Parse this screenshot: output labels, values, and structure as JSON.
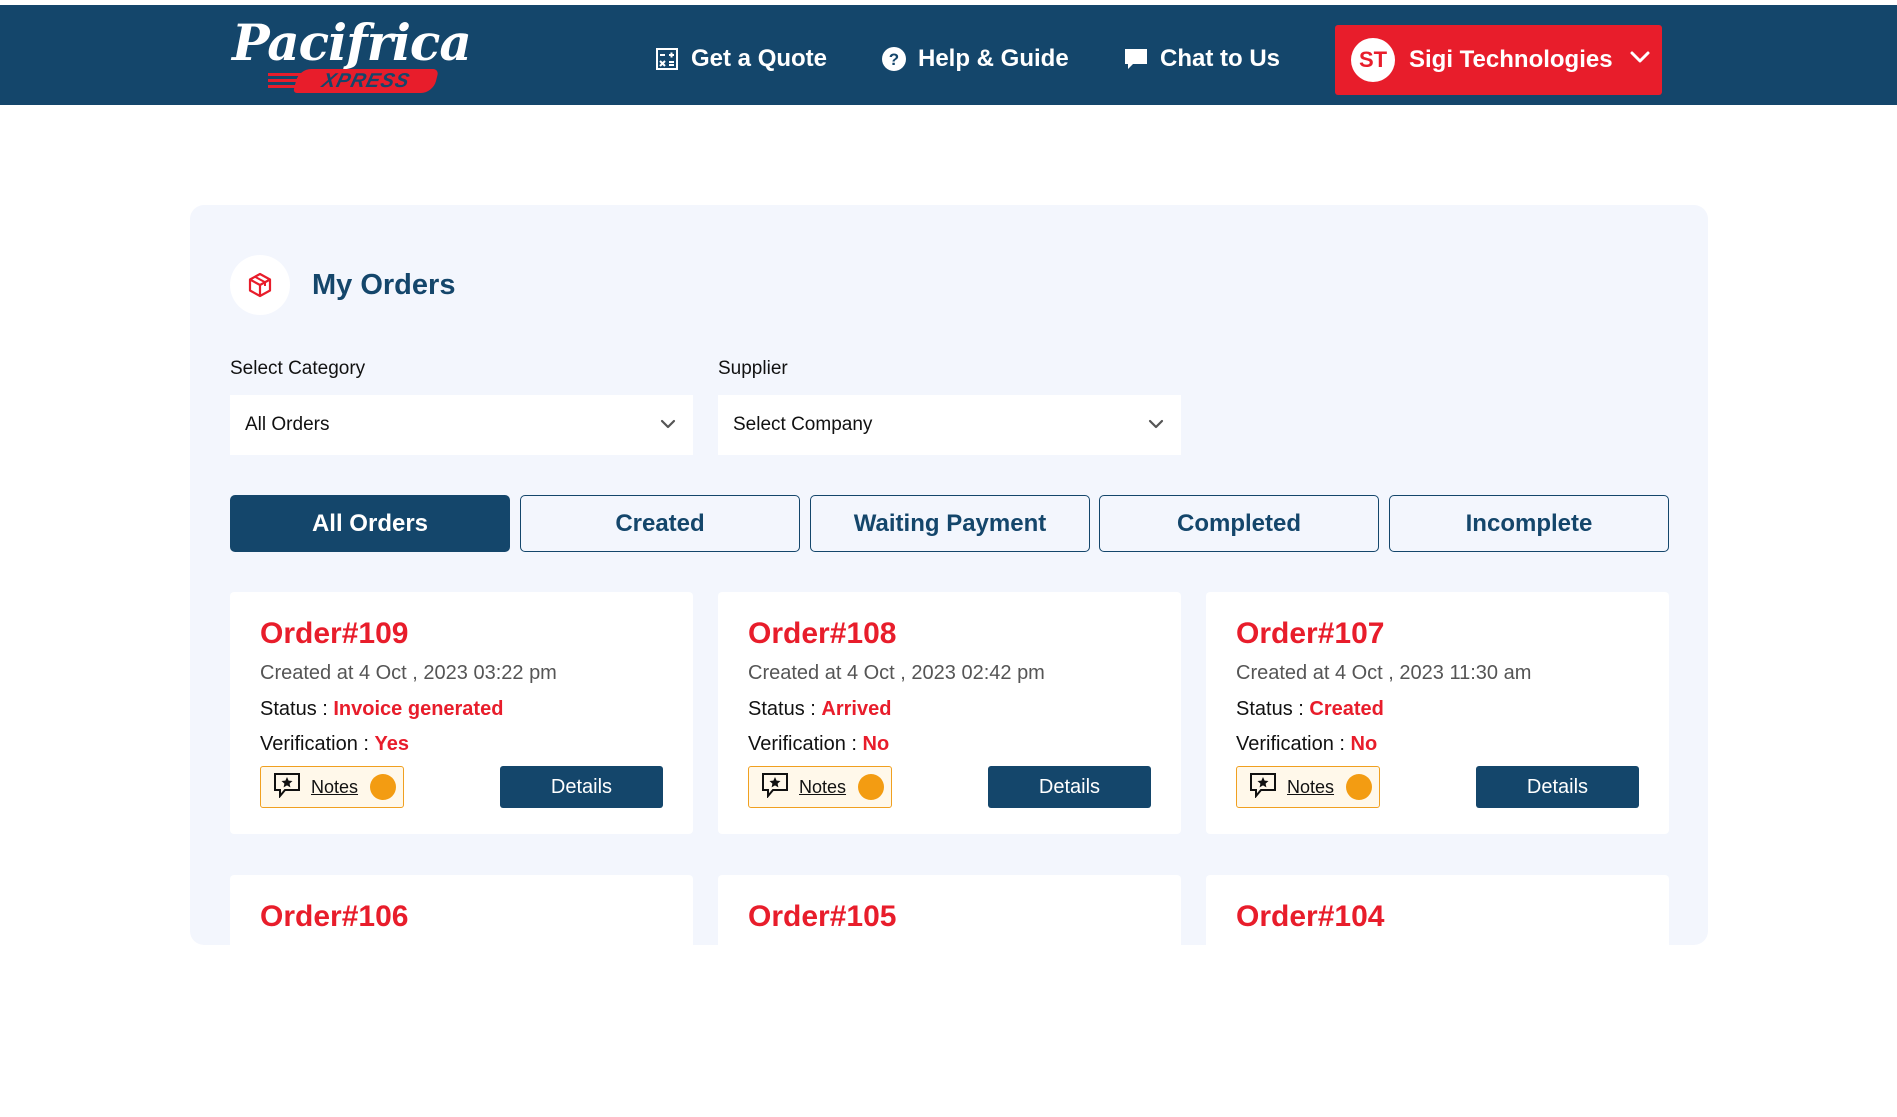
{
  "header": {
    "logo_main": "Pacifrica",
    "logo_tag": "XPRESS",
    "nav": [
      {
        "label": "Get a Quote",
        "icon": "calculator-icon"
      },
      {
        "label": "Help & Guide",
        "icon": "help-circle-icon"
      },
      {
        "label": "Chat to Us",
        "icon": "chat-bubble-icon"
      }
    ],
    "user": {
      "initials": "ST",
      "name": "Sigi Technologies"
    }
  },
  "page": {
    "title": "My Orders",
    "category_label": "Select Category",
    "category_value": "All Orders",
    "supplier_label": "Supplier",
    "supplier_value": "Select Company"
  },
  "tabs": [
    {
      "label": "All Orders",
      "active": true
    },
    {
      "label": "Created",
      "active": false
    },
    {
      "label": "Waiting Payment",
      "active": false
    },
    {
      "label": "Completed",
      "active": false
    },
    {
      "label": "Incomplete",
      "active": false
    }
  ],
  "orders": [
    {
      "title": "Order#109",
      "created": "Created at 4 Oct , 2023 03:22 pm",
      "status_label": "Status :",
      "status": "Invoice generated",
      "verification_label": "Verification :",
      "verification": "Yes",
      "notes_label": "Notes",
      "details_label": "Details"
    },
    {
      "title": "Order#108",
      "created": "Created at 4 Oct , 2023 02:42 pm",
      "status_label": "Status :",
      "status": "Arrived",
      "verification_label": "Verification :",
      "verification": "No",
      "notes_label": "Notes",
      "details_label": "Details"
    },
    {
      "title": "Order#107",
      "created": "Created at 4 Oct , 2023 11:30 am",
      "status_label": "Status :",
      "status": "Created",
      "verification_label": "Verification :",
      "verification": "No",
      "notes_label": "Notes",
      "details_label": "Details"
    },
    {
      "title": "Order#106"
    },
    {
      "title": "Order#105"
    },
    {
      "title": "Order#104"
    }
  ],
  "colors": {
    "primary": "#14466b",
    "accent": "#e81d2b",
    "panel": "#f3f6fd",
    "notes_dot": "#f39c12"
  }
}
